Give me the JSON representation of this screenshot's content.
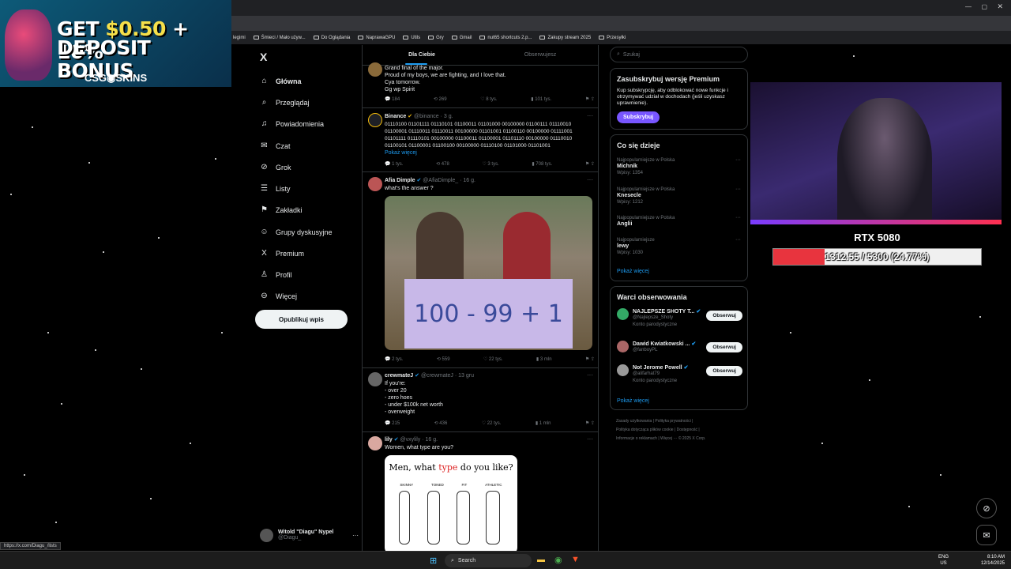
{
  "ad": {
    "line1_prefix": "GET ",
    "line1_amount": "$0.50",
    "line1_suffix": " + 10%",
    "line2": "DEPOSIT BONUS",
    "brand": "CSG◉SKINS"
  },
  "bookmarks": [
    "legimi",
    "Śmieci / Mało używ...",
    "Do Oglądania",
    "NaprawaGPU",
    "Utils",
    "Gry",
    "Gmail",
    "nut65 shortcuts 2.p...",
    "Zakupy stream 2025",
    "Przesyłki"
  ],
  "nav": {
    "logo": "X",
    "items": [
      {
        "label": "Główna",
        "icon": "home-icon",
        "glyph": "⌂"
      },
      {
        "label": "Przeglądaj",
        "icon": "search-icon",
        "glyph": "⌕"
      },
      {
        "label": "Powiadomienia",
        "icon": "bell-icon",
        "glyph": "♫"
      },
      {
        "label": "Czat",
        "icon": "mail-icon",
        "glyph": "✉"
      },
      {
        "label": "Grok",
        "icon": "grok-icon",
        "glyph": "⊘"
      },
      {
        "label": "Listy",
        "icon": "list-icon",
        "glyph": "☰"
      },
      {
        "label": "Zakładki",
        "icon": "bookmark-icon",
        "glyph": "⚑"
      },
      {
        "label": "Grupy dyskusyjne",
        "icon": "people-icon",
        "glyph": "☺"
      },
      {
        "label": "Premium",
        "icon": "x-premium-icon",
        "glyph": "X"
      },
      {
        "label": "Profil",
        "icon": "person-icon",
        "glyph": "♙"
      },
      {
        "label": "Więcej",
        "icon": "more-circle-icon",
        "glyph": "⊖"
      }
    ],
    "post_label": "Opublikuj wpis",
    "profile_name": "Witold \"Diagu\" Nypel",
    "profile_handle": "@Diagu_"
  },
  "feed": {
    "tabs": [
      "Dla Ciebie",
      "Obserwujesz"
    ],
    "tweets": [
      {
        "name": "",
        "handle": "",
        "text": "Grand final of the major.\nProud of my boys, we are fighting, and I love that.\nCya tomorrow.\nGg wp Spirit",
        "replies": "184",
        "retweets": "269",
        "likes": "8 tys.",
        "views": "101 tys."
      },
      {
        "name": "Binance",
        "handle": "@binance · 3 g.",
        "text": "01110100 01101111 01110101 01100011 01101000 00100000 01100111 01110010\n01100001 01110011 01110011 00100000 01101001 01100110 00100000 01111001\n01101111 01110101 00100000 01100011 01100001 01101110 00100000 01110010\n01100101 01100001 01100100 00100000 01110100 01101000 01101001",
        "more": "Pokaż więcej",
        "replies": "1 tys.",
        "retweets": "478",
        "likes": "3 tys.",
        "views": "708 tys."
      },
      {
        "name": "Afia Dimple",
        "handle": "@AfiaDimple_ · 16 g.",
        "text": "what's the answer ?",
        "image_text": "100 - 99 + 1",
        "replies": "2 tys.",
        "retweets": "559",
        "likes": "22 tys.",
        "views": "3 mln"
      },
      {
        "name": "crewmateJ",
        "handle": "@crewmateJ · 13 gru",
        "text": "If you're:\n- over 20\n- zero hoes\n- under $100k net worth\n- overweight",
        "replies": "215",
        "retweets": "436",
        "likes": "22 tys.",
        "views": "1 mln"
      },
      {
        "name": "lily",
        "handle": "@vxylily · 16 g.",
        "text": "Women, what type are you?",
        "image_title_a": "Men, what ",
        "image_title_b": "type",
        "image_title_c": " do you like?",
        "types": [
          "SKINNY",
          "TONED",
          "FIT",
          "ATHLETIC"
        ]
      }
    ]
  },
  "right": {
    "search_placeholder": "Szukaj",
    "premium": {
      "title": "Zasubskrybuj wersję Premium",
      "text": "Kup subskrypcję, aby odblokować nowe funkcje i otrzymywać udział w dochodach (jeśli uzyskasz uprawnienie).",
      "button": "Subskrybuj"
    },
    "trends": {
      "title": "Co się dzieje",
      "items": [
        {
          "context": "Najpopularniejsze w Polska",
          "name": "Michnik",
          "posts": "Wpisy: 1354"
        },
        {
          "context": "Najpopularniejsze w Polska",
          "name": "Knesecle",
          "posts": "Wpisy: 1212"
        },
        {
          "context": "Najpopularniejsze w Polska",
          "name": "Anglii",
          "posts": ""
        },
        {
          "context": "Najpopularniejsze",
          "name": "lewy",
          "posts": "Wpisy: 1030"
        }
      ],
      "more": "Pokaż więcej"
    },
    "who": {
      "title": "Warci obserwowania",
      "items": [
        {
          "name": "NAJLEPSZE SHOTY T...",
          "handle": "@Najlepsze_Shoty",
          "note": "Konto parodystyczne",
          "button": "Obserwuj"
        },
        {
          "name": "Dawid Kwiatkowski ...",
          "handle": "@fanboyPL",
          "note": "",
          "button": "Obserwuj"
        },
        {
          "name": "Not Jerome Powell",
          "handle": "@alifarhat79",
          "note": "Konto parodystyczne",
          "button": "Obserwuj"
        }
      ],
      "more": "Pokaż więcej"
    },
    "footer": [
      "Zasady użytkowania",
      "Polityka prywatności",
      "Polityka dotycząca plików cookie",
      "Dostępność",
      "Informacje o reklamach",
      "Więcej ···",
      "© 2025 X Corp."
    ]
  },
  "overlay": {
    "gpu_title": "RTX 5080",
    "gpu_progress": "1312.55 / 5300 (24.77%)",
    "gpu_fraction": 0.2477
  },
  "status_url": "https://x.com/Diagu_/lists",
  "taskbar": {
    "search": "Search",
    "lang1": "ENG",
    "lang2": "US",
    "time": "8:10 AM",
    "date": "12/14/2025"
  }
}
